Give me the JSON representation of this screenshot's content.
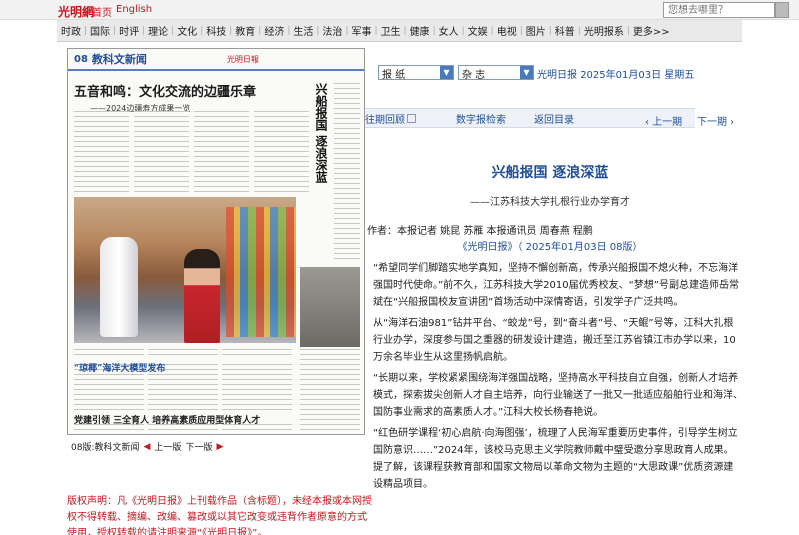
{
  "site": {
    "logo_text": "光明網",
    "links": [
      "首页",
      "English"
    ],
    "search_placeholder": "您想去哪里？"
  },
  "nav": [
    "时政",
    "国际",
    "时评",
    "理论",
    "文化",
    "科技",
    "教育",
    "经济",
    "生活",
    "法治",
    "军事",
    "卫生",
    "健康",
    "女人",
    "文娱",
    "电视",
    "图片",
    "科普",
    "光明报系",
    "更多>>"
  ],
  "page": {
    "num": "08",
    "section": "教科文新闻",
    "masthead": "光明日報",
    "headline": "五音和鸣：文化交流的边疆乐章",
    "subline": "——2024边疆寿方成果一览",
    "vertical_title": "兴船报国 逐浪深蓝",
    "lower_headline": "“琼椰”海洋大模型发布",
    "lower_subline": "党建引领  三全育人  培养高素质应用型体育人才"
  },
  "pagenav": {
    "label": "08版:教科文新闻",
    "prev": "上一版",
    "next": "下一版"
  },
  "copyright": "版权声明：凡《光明日报》上刊载作品（含标题），未经本报或本网授权不得转载、摘编、改编、篡改或以其它改变或违背作者原意的方式使用，授权转载的请注明来源“《光明日报》”。",
  "selectors": {
    "newspaper": "报 纸",
    "magazine": "杂 志"
  },
  "pubinfo": {
    "paper": "光明日报",
    "date": "2025年01月03日",
    "weekday": "星期五"
  },
  "toolbar": {
    "back_issue": "往期回顾",
    "digital_search": "数字报检索",
    "return_toc": "返回目录",
    "prev_page": "上一期",
    "next_page": "下一期"
  },
  "article": {
    "title": "兴船报国 逐浪深蓝",
    "subtitle": "——江苏科技大学扎根行业办学育才",
    "author": "作者：本报记者 姚昆 苏雁 本报通讯员 周春燕 程鹏",
    "source": "《光明日报》（ 2025年01月03日  08版）",
    "paragraphs": [
      "“希望同学们脚踏实地学真知，坚持不懈创新高，传承兴船报国不熄火种，不忘海洋强国时代使命。”前不久，江苏科技大学2010届优秀校友、“梦想”号副总建造师岳常斌在“兴船报国校友宣讲团”首场活动中深情寄语，引发学子广泛共鸣。",
      "从“海洋石油981”钻井平台、“蛟龙”号，到“奋斗者”号、“天鲲”号等，江科大扎根行业办学，深度参与国之重器的研发设计建造，搬迁至江苏省镇江市办学以来，10万余名毕业生从这里扬帆启航。",
      "“长期以来，学校紧紧围绕海洋强国战略，坚持高水平科技自立自强，创新人才培养模式，探索拔尖创新人才自主培养，向行业输送了一批又一批适应船舶行业和海洋、国防事业需求的高素质人才。”江科大校长杨春艳说。",
      "“红色研学课程‘初心启航·向海图强’，梳理了人民海军重要历史事件，引导学生树立国防意识……”2024年，该校马克思主义学院教师戴中璧受邀分享思政育人成果。提了解，该课程获教育部和国家文物局以革命文物为主题的“大思政课”优质资源建设精品项目。"
    ]
  }
}
